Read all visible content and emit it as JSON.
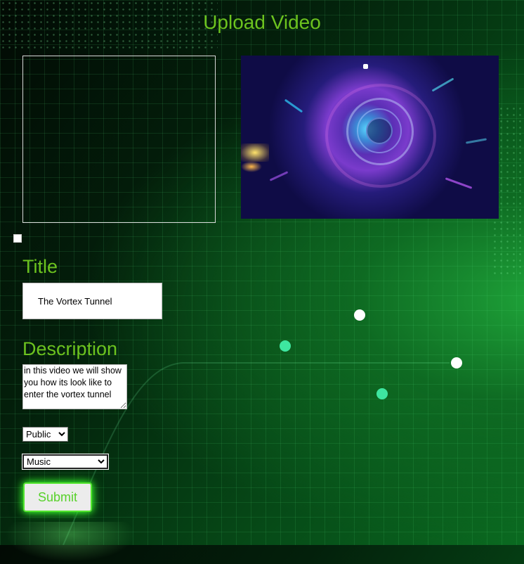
{
  "page": {
    "heading": "Upload Video"
  },
  "form": {
    "title_label": "Title",
    "title_value": "The Vortex Tunnel",
    "description_label": "Description",
    "description_value": "in this video we will show you how its look like to enter the vortex tunnel",
    "visibility_options": [
      "Public"
    ],
    "visibility_selected": "Public",
    "category_options": [
      "Music"
    ],
    "category_selected": "Music",
    "submit_label": "Submit"
  },
  "colors": {
    "accent_green": "#6cc31f",
    "button_glow": "#54e52f",
    "background_dark": "#020a04",
    "background_green": "#0a6a20"
  },
  "icons": {
    "file_checkbox": "checkbox-square",
    "select_arrow": "chevron-down-icon"
  }
}
